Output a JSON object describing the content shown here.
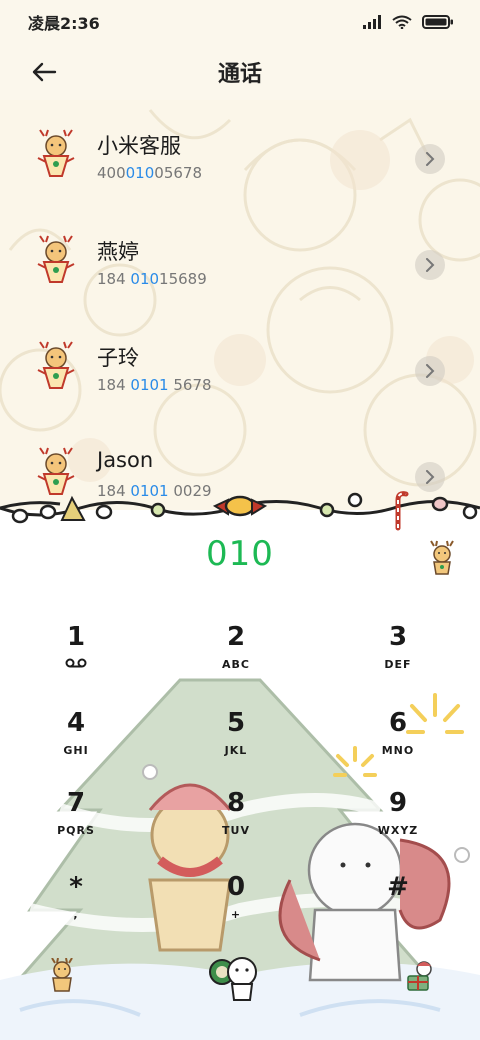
{
  "status_bar": {
    "time": "凌晨2:36"
  },
  "header": {
    "title": "通话"
  },
  "contacts": [
    {
      "name": "小米客服",
      "num_pre": "400",
      "num_hl": "010",
      "num_post": "05678"
    },
    {
      "name": "燕婷",
      "num_pre": "184 ",
      "num_hl": "010",
      "num_post": "15689"
    },
    {
      "name": "子玲",
      "num_pre": "184 ",
      "num_hl": "0101",
      "num_post": " 5678"
    },
    {
      "name": "Jason",
      "num_pre": "184 ",
      "num_hl": "0101",
      "num_post": " 0029"
    }
  ],
  "dialer": {
    "input": "010",
    "keys": [
      {
        "digit": "1",
        "letters": ""
      },
      {
        "digit": "2",
        "letters": "ABC"
      },
      {
        "digit": "3",
        "letters": "DEF"
      },
      {
        "digit": "4",
        "letters": "GHI"
      },
      {
        "digit": "5",
        "letters": "JKL"
      },
      {
        "digit": "6",
        "letters": "MNO"
      },
      {
        "digit": "7",
        "letters": "PQRS"
      },
      {
        "digit": "8",
        "letters": "TUV"
      },
      {
        "digit": "9",
        "letters": "WXYZ"
      },
      {
        "digit": "*",
        "letters": ","
      },
      {
        "digit": "0",
        "letters": "+"
      },
      {
        "digit": "#",
        "letters": ""
      }
    ]
  },
  "colors": {
    "accent_green": "#1db954",
    "match_blue": "#2a8be8"
  },
  "icons": {
    "status": [
      "signal-icon",
      "wifi-icon",
      "battery-icon"
    ],
    "voicemail": "voicemail-icon",
    "back": "back-arrow-icon",
    "chevron": "chevron-right-icon"
  }
}
